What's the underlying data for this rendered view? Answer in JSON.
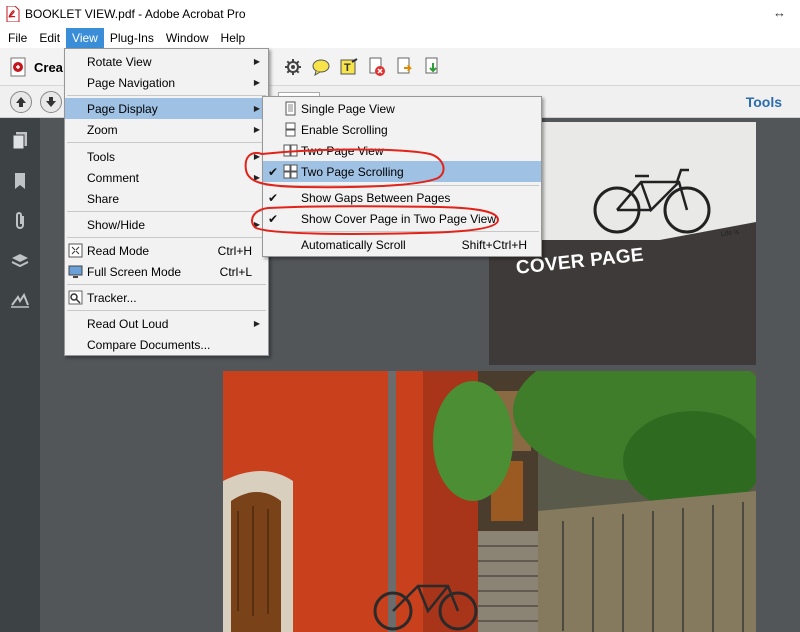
{
  "window": {
    "title": "BOOKLET VIEW.pdf - Adobe Acrobat Pro",
    "resize_glyph": "↔"
  },
  "menubar": [
    {
      "label": "File"
    },
    {
      "label": "Edit"
    },
    {
      "label": "View",
      "active": true
    },
    {
      "label": "Plug-Ins"
    },
    {
      "label": "Window"
    },
    {
      "label": "Help"
    }
  ],
  "toolbar": {
    "create_label": "Crea",
    "tools_label": "Tools",
    "icons": [
      "gear-icon",
      "comment-icon",
      "highlight-icon",
      "delete-file-icon",
      "forward-icon",
      "export-icon"
    ]
  },
  "view_menu": {
    "items": [
      {
        "label": "Rotate View",
        "submenu": true
      },
      {
        "label": "Page Navigation",
        "submenu": true
      },
      {
        "label": "Page Display",
        "submenu": true,
        "highlighted": true
      },
      {
        "label": "Zoom",
        "submenu": true
      },
      {
        "label": "Tools",
        "submenu": true
      },
      {
        "label": "Comment",
        "submenu": true
      },
      {
        "label": "Share"
      },
      {
        "label": "Show/Hide",
        "submenu": true
      },
      {
        "label": "Read Mode",
        "shortcut": "Ctrl+H",
        "icon": "read-mode-icon"
      },
      {
        "label": "Full Screen Mode",
        "shortcut": "Ctrl+L",
        "icon": "full-screen-icon"
      },
      {
        "label": "Tracker...",
        "icon": "tracker-icon"
      },
      {
        "label": "Read Out Loud",
        "submenu": true
      },
      {
        "label": "Compare Documents..."
      }
    ]
  },
  "page_display_menu": {
    "items": [
      {
        "label": "Single Page View",
        "icon": "single-page-icon"
      },
      {
        "label": "Enable Scrolling",
        "icon": "scrolling-icon"
      },
      {
        "label": "Two Page View",
        "icon": "two-page-icon"
      },
      {
        "label": "Two Page Scrolling",
        "icon": "two-page-scrolling-icon",
        "checked": true,
        "highlighted": true
      },
      {
        "label": "Show Gaps Between Pages",
        "checked": true
      },
      {
        "label": "Show Cover Page in Two Page View",
        "checked": true
      },
      {
        "label": "Automatically Scroll",
        "shortcut": "Shift+Ctrl+H"
      }
    ]
  },
  "document": {
    "cover_title": "COVER PAGE",
    "cover_small_text": "Life is"
  },
  "colors": {
    "accent": "#3a8ed8",
    "highlight": "#9fc1e3",
    "annotation": "#e2231a",
    "panel": "#3d4245",
    "canvas": "#525659"
  }
}
